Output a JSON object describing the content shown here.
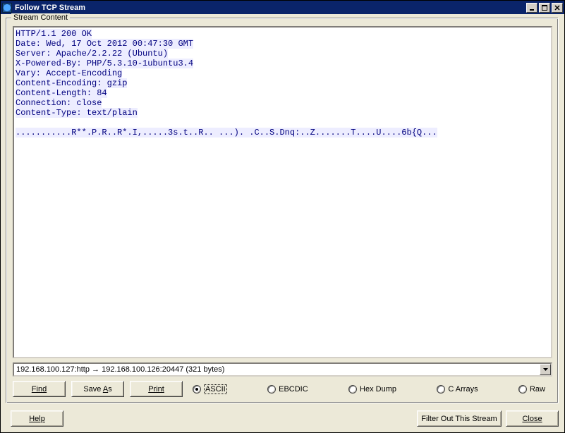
{
  "window": {
    "title": "Follow TCP Stream"
  },
  "group": {
    "legend": "Stream Content"
  },
  "stream": {
    "text": "HTTP/1.1 200 OK\nDate: Wed, 17 Oct 2012 00:47:30 GMT\nServer: Apache/2.2.22 (Ubuntu)\nX-Powered-By: PHP/5.3.10-1ubuntu3.4\nVary: Accept-Encoding\nContent-Encoding: gzip\nContent-Length: 84\nConnection: close\nContent-Type: text/plain\n\n...........R**.P.R..R*.I,.....3s.t..R.. ...). .C..S.Dnq:..Z.......T....U....6b{Q..."
  },
  "combo": {
    "value": "192.168.100.127:http → 192.168.100.126:20447 (321 bytes)"
  },
  "buttons": {
    "find": "Find",
    "save_as_pre": "Save ",
    "save_as_u": "A",
    "save_as_post": "s",
    "print": "Print",
    "help": "Help",
    "filter_out": "Filter Out This Stream",
    "close": "Close"
  },
  "radios": {
    "ascii": "ASCII",
    "ebcdic": "EBCDIC",
    "hexdump": "Hex Dump",
    "carrays": "C Arrays",
    "raw": "Raw"
  }
}
